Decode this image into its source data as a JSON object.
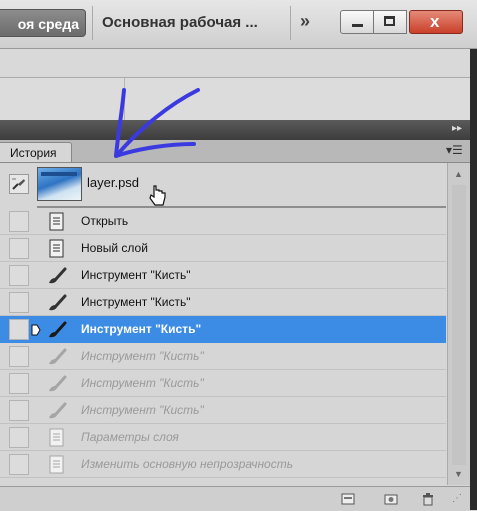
{
  "topbar": {
    "workspace_button": "оя среда",
    "workspace_title": "Основная рабочая ...",
    "more_glyph": "»",
    "close_glyph": "x"
  },
  "panel": {
    "tab_label": "История",
    "snapshot": {
      "name": "layer.psd"
    },
    "history": [
      {
        "label": "Открыть",
        "icon": "document-icon",
        "state": "normal"
      },
      {
        "label": "Новый слой",
        "icon": "document-icon",
        "state": "normal"
      },
      {
        "label": "Инструмент \"Кисть\"",
        "icon": "brush-icon",
        "state": "normal"
      },
      {
        "label": "Инструмент \"Кисть\"",
        "icon": "brush-icon",
        "state": "normal"
      },
      {
        "label": "Инструмент \"Кисть\"",
        "icon": "brush-icon",
        "state": "selected"
      },
      {
        "label": "Инструмент \"Кисть\"",
        "icon": "brush-icon",
        "state": "dimmed"
      },
      {
        "label": "Инструмент \"Кисть\"",
        "icon": "brush-icon",
        "state": "dimmed"
      },
      {
        "label": "Инструмент \"Кисть\"",
        "icon": "brush-icon",
        "state": "dimmed"
      },
      {
        "label": "Параметры слоя",
        "icon": "document-icon",
        "state": "dimmed"
      },
      {
        "label": "Изменить основную непрозрачность",
        "icon": "document-icon",
        "state": "dimmed"
      }
    ]
  },
  "colors": {
    "selection": "#3c8ce6",
    "annotation": "#3a3ae0",
    "close_button": "#c9402a"
  }
}
